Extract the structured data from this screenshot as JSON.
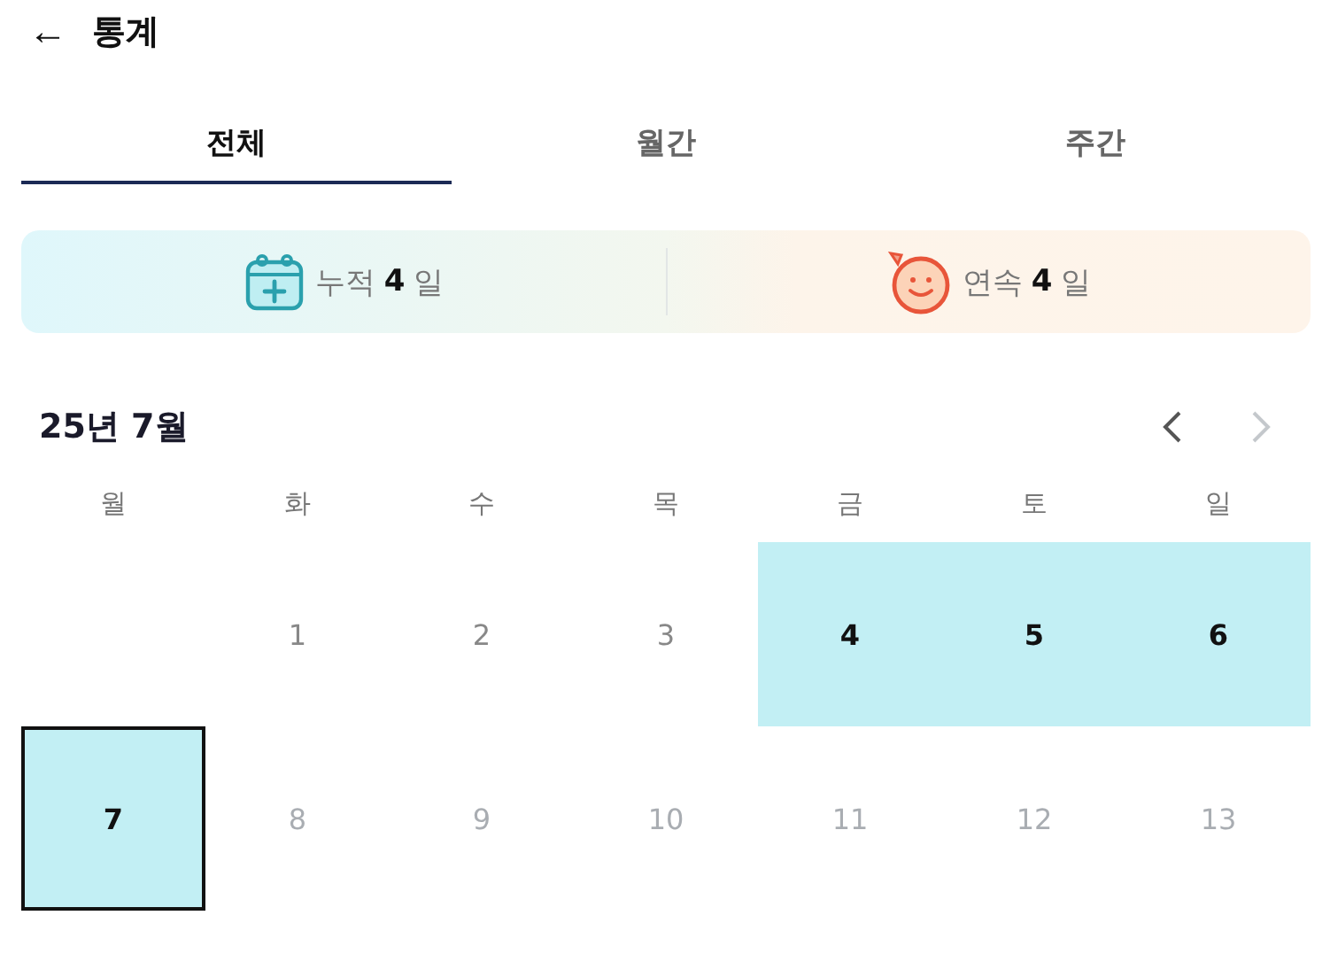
{
  "header": {
    "back_icon": "←",
    "title": "통계"
  },
  "tabs": [
    {
      "label": "전체",
      "selected": true
    },
    {
      "label": "월간",
      "selected": false
    },
    {
      "label": "주간",
      "selected": false
    }
  ],
  "stats": [
    {
      "kind": "calendar",
      "label": "누적",
      "value": "4",
      "unit": "일"
    },
    {
      "kind": "streak",
      "label": "연속",
      "value": "4",
      "unit": "일"
    }
  ],
  "calendar": {
    "title": "25년 7월",
    "prev": {
      "disabled": false
    },
    "next": {
      "disabled": true
    },
    "weekdays": [
      "월",
      "화",
      "수",
      "목",
      "금",
      "토",
      "일"
    ],
    "weeks": [
      [
        {
          "kind": "blank"
        },
        {
          "kind": "past",
          "day": "1",
          "today": false
        },
        {
          "kind": "past",
          "day": "2",
          "today": false
        },
        {
          "kind": "past",
          "day": "3",
          "today": false
        },
        {
          "kind": "recorded",
          "day": "4",
          "today": false
        },
        {
          "kind": "recorded",
          "day": "5",
          "today": false
        },
        {
          "kind": "recorded",
          "day": "6",
          "today": false
        }
      ],
      [
        {
          "kind": "recorded",
          "day": "7",
          "today": true
        },
        {
          "kind": "future",
          "day": "8",
          "today": false
        },
        {
          "kind": "future",
          "day": "9",
          "today": false
        },
        {
          "kind": "future",
          "day": "10",
          "today": false
        },
        {
          "kind": "future",
          "day": "11",
          "today": false
        },
        {
          "kind": "future",
          "day": "12",
          "today": false
        },
        {
          "kind": "future",
          "day": "13",
          "today": false
        }
      ]
    ]
  }
}
